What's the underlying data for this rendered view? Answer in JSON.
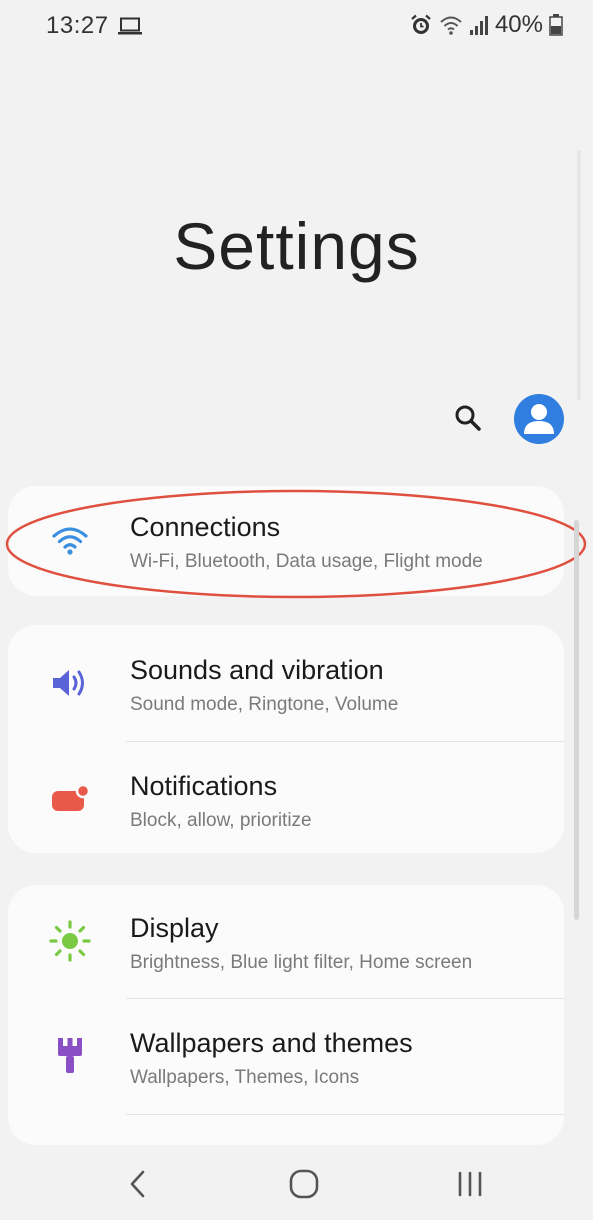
{
  "status_bar": {
    "time": "13:27",
    "battery": "40%",
    "icons": [
      "laptop-icon",
      "alarm-icon",
      "wifi-icon",
      "signal-icon",
      "battery-icon"
    ]
  },
  "page": {
    "title": "Settings"
  },
  "actions": {
    "icons": [
      "search-icon",
      "profile-icon"
    ],
    "profile_color": "#2f7ee0"
  },
  "settings": [
    {
      "title": "Connections",
      "subtitle": "Wi-Fi, Bluetooth, Data usage, Flight mode",
      "icon": "wifi-icon",
      "icon_color": "#3a8fe0",
      "highlighted": true
    },
    {
      "title": "Sounds and vibration",
      "subtitle": "Sound mode, Ringtone, Volume",
      "icon": "speaker-icon",
      "icon_color": "#5a63d8"
    },
    {
      "title": "Notifications",
      "subtitle": "Block, allow, prioritize",
      "icon": "notification-icon",
      "icon_color": "#e8594a"
    },
    {
      "title": "Display",
      "subtitle": "Brightness, Blue light filter, Home screen",
      "icon": "sun-icon",
      "icon_color": "#7ac943"
    },
    {
      "title": "Wallpapers and themes",
      "subtitle": "Wallpapers, Themes, Icons",
      "icon": "paintbrush-icon",
      "icon_color": "#8a4fc4"
    }
  ],
  "annotation": {
    "color": "#e05040"
  },
  "nav_bar": {
    "icons": [
      "back-icon",
      "home-icon",
      "recent-apps-icon"
    ]
  }
}
